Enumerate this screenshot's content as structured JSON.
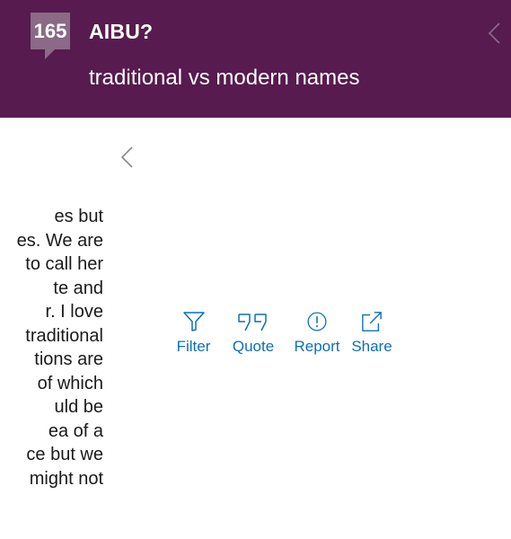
{
  "header": {
    "count": "165",
    "topic": "AIBU?",
    "thread_title": "traditional vs modern names",
    "background": "#571b4f"
  },
  "icons": {
    "header_back": "chevron-left-icon",
    "panel_back": "chevron-left-icon"
  },
  "post": {
    "lines": [
      "es but",
      "es. We are",
      "to call her",
      "te and",
      "r.  I love",
      "traditional",
      "tions are",
      "of which",
      "uld be",
      "ea of a",
      "ce but we",
      "might not"
    ]
  },
  "actions": [
    {
      "label": "Filter",
      "icon": "filter-icon"
    },
    {
      "label": "Quote",
      "icon": "quote-icon"
    },
    {
      "label": "Report",
      "icon": "report-icon"
    },
    {
      "label": "Share",
      "icon": "share-icon"
    }
  ],
  "colors": {
    "accent": "#0d6fb8",
    "badge": "#8a6a86"
  }
}
